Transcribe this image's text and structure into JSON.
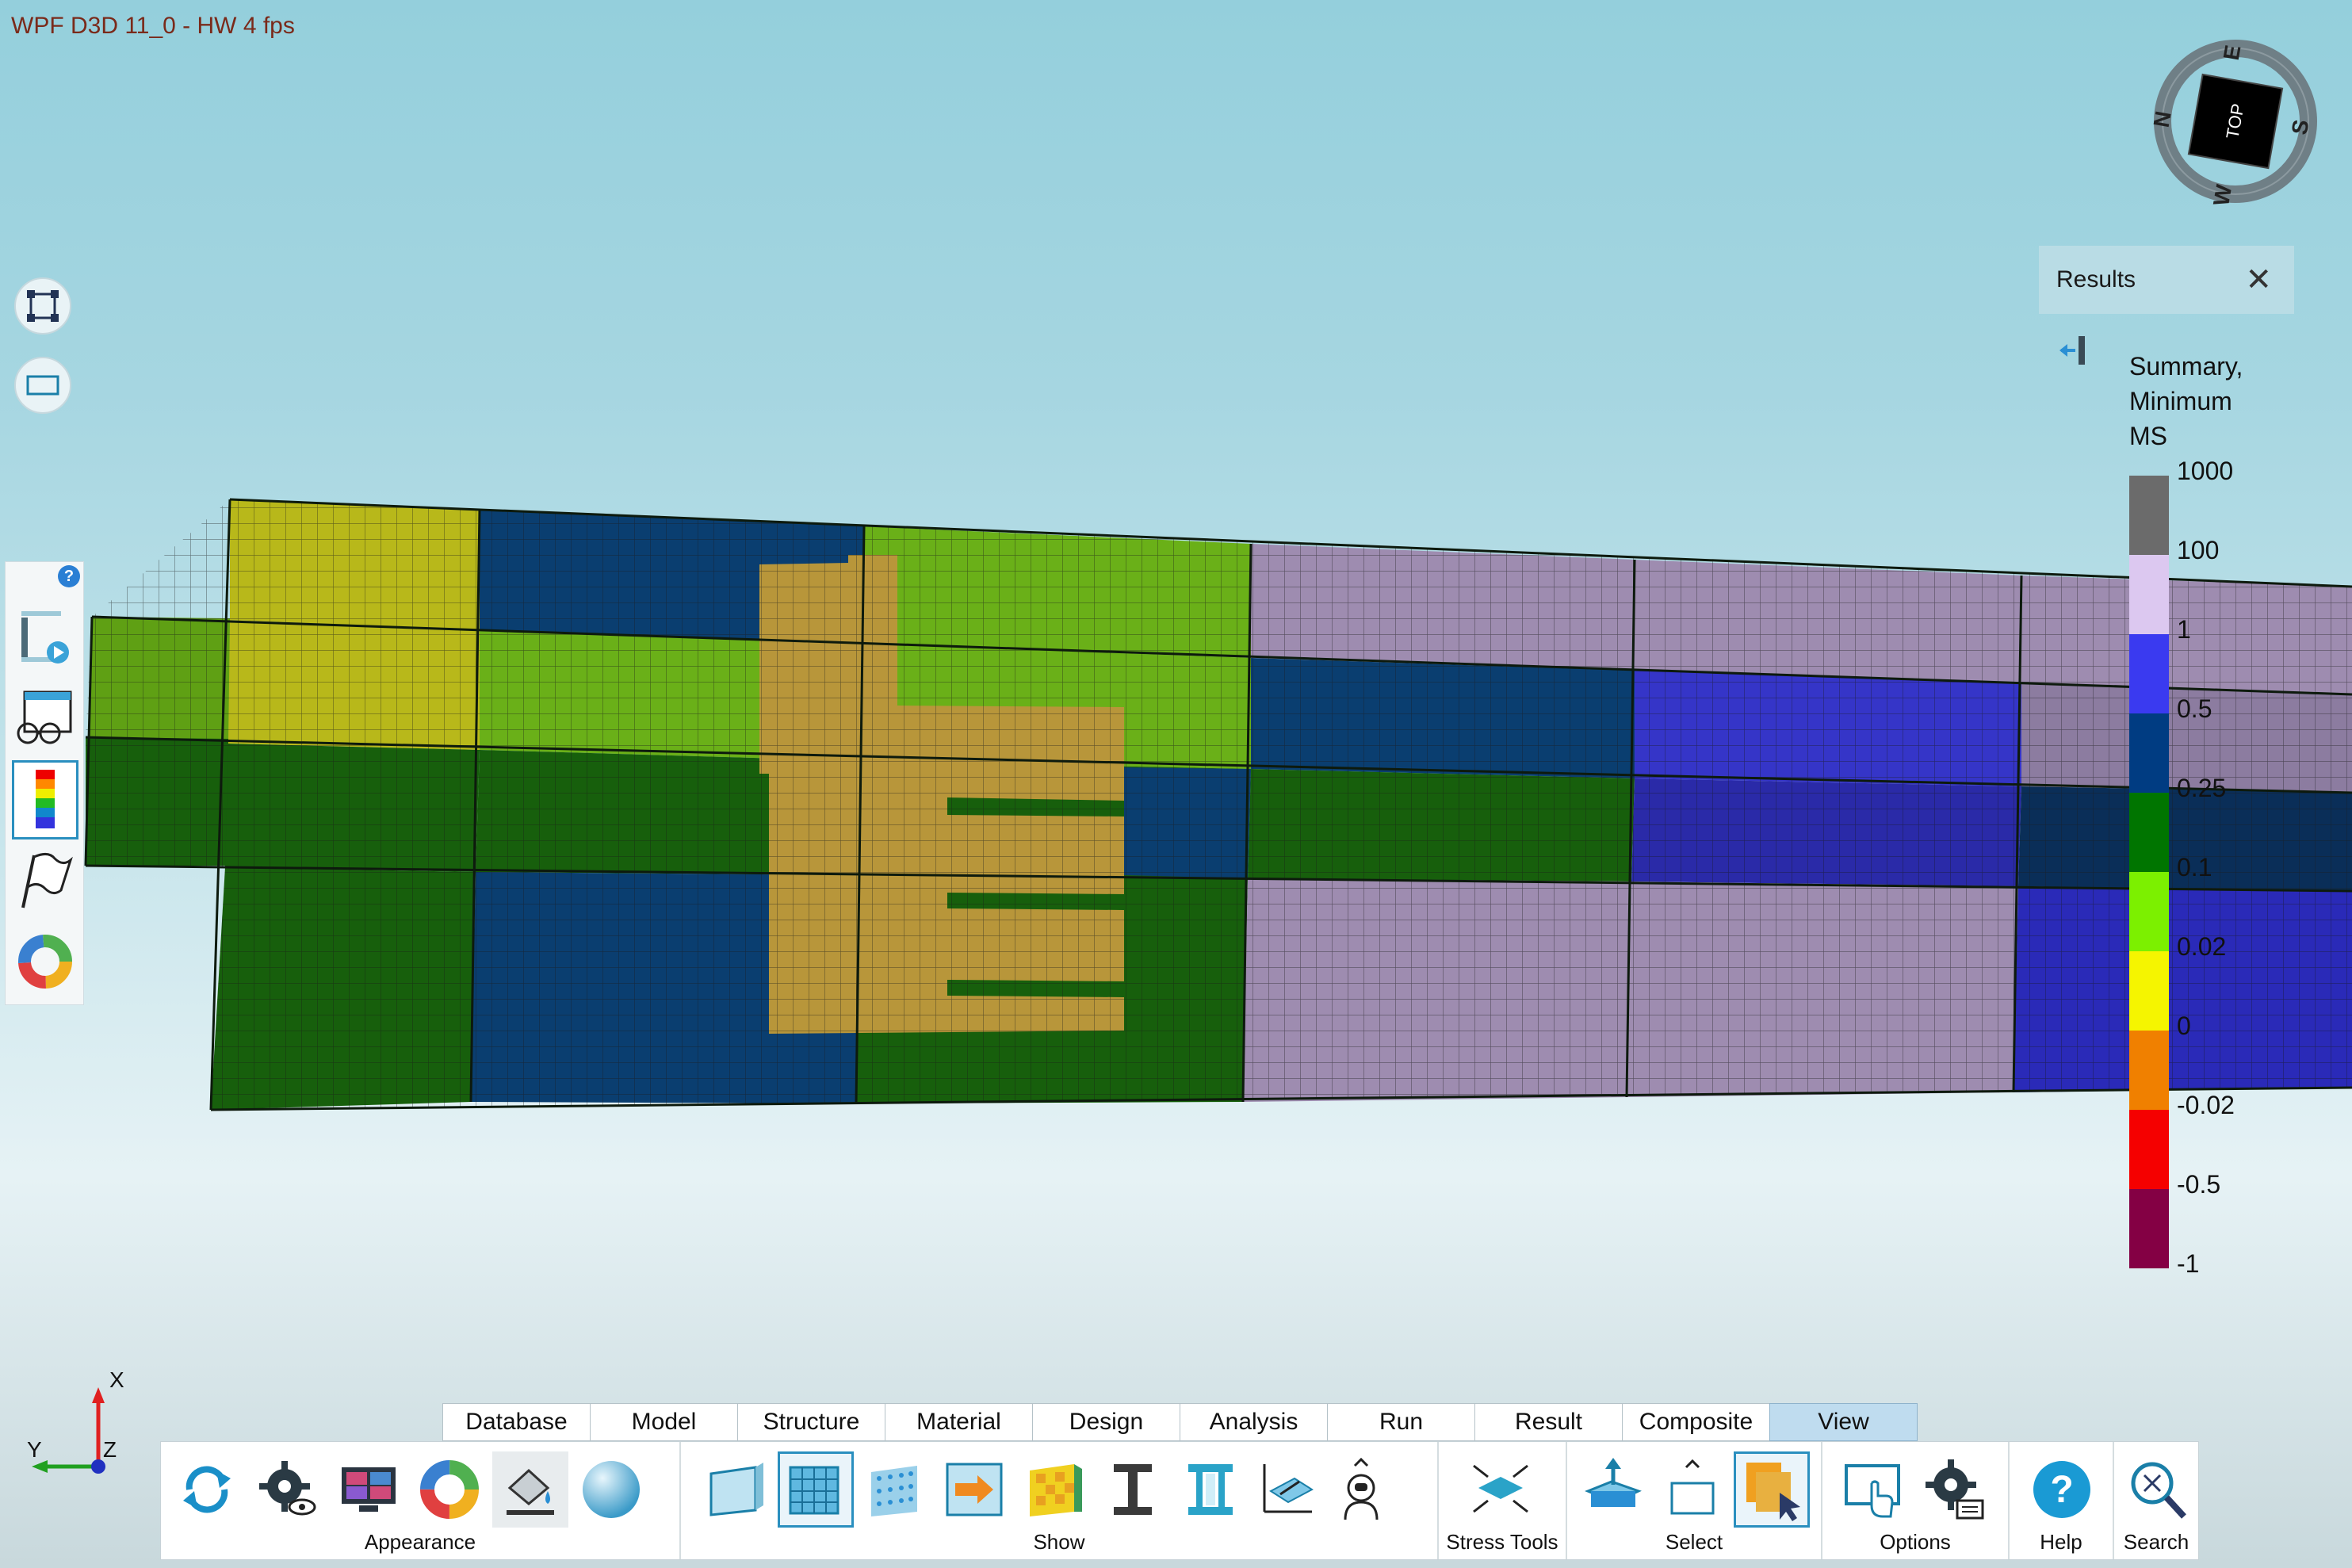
{
  "window": {
    "title": "WPF D3D 11_0 - HW  4  fps"
  },
  "compass": {
    "center_label": "TOP",
    "north": "N",
    "east": "E",
    "south": "S",
    "west": "W"
  },
  "view_buttons": [
    {
      "name": "fit-view-icon"
    },
    {
      "name": "rectangle-zoom-icon"
    }
  ],
  "left_toolbar": {
    "help": "?",
    "items": [
      {
        "name": "section-play-icon"
      },
      {
        "name": "view-glasses-icon"
      },
      {
        "name": "color-legend-icon",
        "active": true
      },
      {
        "name": "flag-icon"
      },
      {
        "name": "color-wheel-icon"
      }
    ]
  },
  "results_panel": {
    "title": "Results",
    "close": "✕",
    "legend_title_lines": [
      "Summary,",
      "Minimum",
      "MS"
    ],
    "legend_labels": [
      "1000",
      "100",
      "1",
      "0.5",
      "0.25",
      "0.1",
      "0.02",
      "0",
      "-0.02",
      "-0.5",
      "-1"
    ],
    "legend_colors": [
      "#6b6b6b",
      "#dcc8f0",
      "#3a3af0",
      "#003c82",
      "#007500",
      "#7cf000",
      "#f5f500",
      "#f08000",
      "#f50000",
      "#840044"
    ]
  },
  "triad": {
    "x": "X",
    "y": "Y",
    "z": "Z"
  },
  "tabs": [
    "Database",
    "Model",
    "Structure",
    "Material",
    "Design",
    "Analysis",
    "Run",
    "Result",
    "Composite",
    "View"
  ],
  "active_tab": "View",
  "ribbon": {
    "appearance": {
      "label": "Appearance"
    },
    "show": {
      "label": "Show"
    },
    "stress_tools": {
      "label": "Stress Tools"
    },
    "select": {
      "label": "Select"
    },
    "options": {
      "label": "Options"
    },
    "help": {
      "label": "Help"
    },
    "search": {
      "label": "Search"
    }
  }
}
